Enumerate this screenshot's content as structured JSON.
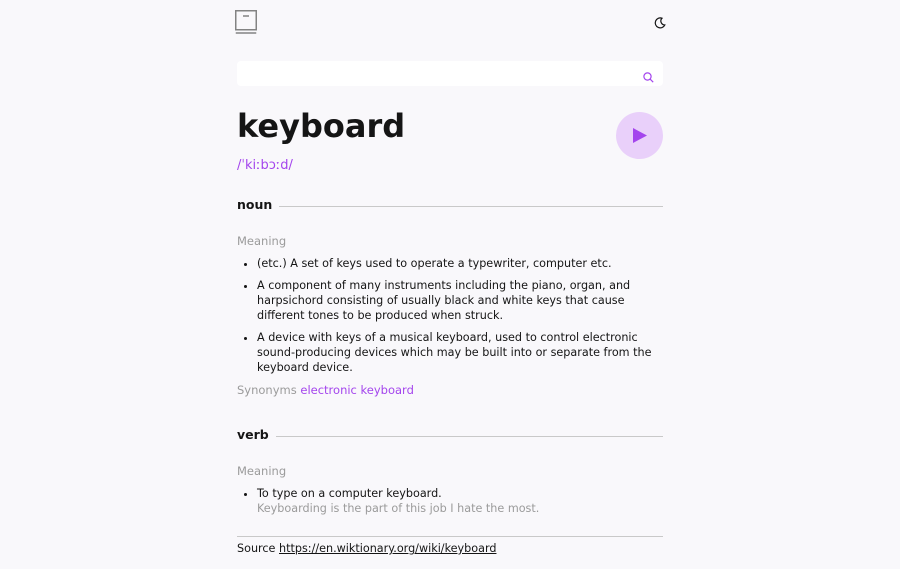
{
  "search": {
    "value": "",
    "placeholder": ""
  },
  "entry": {
    "word": "keyboard",
    "phonetic": "/ˈkiːbɔːd/"
  },
  "meanings": [
    {
      "part_of_speech": "noun",
      "label": "Meaning",
      "definitions": [
        "(etc.) A set of keys used to operate a typewriter, computer etc.",
        "A component of many instruments including the piano, organ, and harpsichord consisting of usually black and white keys that cause different tones to be produced when struck.",
        "A device with keys of a musical keyboard, used to control electronic sound-producing devices which may be built into or separate from the keyboard device."
      ],
      "synonyms_label": "Synonyms",
      "synonyms": [
        "electronic keyboard"
      ]
    },
    {
      "part_of_speech": "verb",
      "label": "Meaning",
      "definitions": [
        {
          "text": "To type on a computer keyboard.",
          "example": "Keyboarding is the part of this job I hate the most."
        }
      ]
    }
  ],
  "source": {
    "label": "Source",
    "url": "https://en.wiktionary.org/wiki/keyboard"
  },
  "colors": {
    "accent": "#a445ed",
    "play_bg": "#e9d0fa",
    "muted": "#9b9b9b",
    "text": "#151515"
  },
  "icons": {
    "logo": "book-icon",
    "theme": "moon-icon",
    "search": "search-icon",
    "play": "play-icon"
  }
}
